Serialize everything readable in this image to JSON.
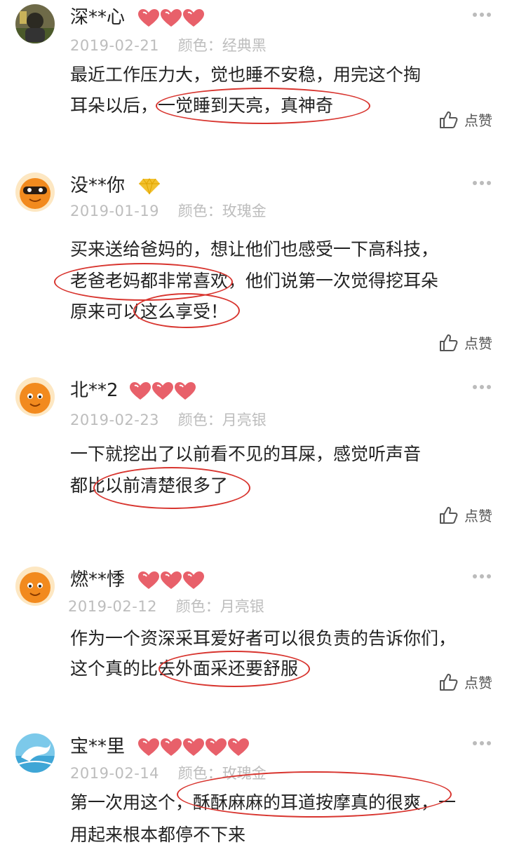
{
  "like_label": "点赞",
  "color_prefix": "颜色：",
  "reviews": [
    {
      "user": "深**心",
      "date": "2019-02-21",
      "color": "经典黑",
      "rating_type": "hearts",
      "rating": 3,
      "lines": [
        "最近工作压力大，觉也睡不安稳，用完这个掏",
        "耳朵以后，一觉睡到天亮，真神奇"
      ]
    },
    {
      "user": "没**你",
      "date": "2019-01-19",
      "color": "玫瑰金",
      "rating_type": "diamond",
      "rating": 1,
      "lines": [
        "买来送给爸妈的，想让他们也感受一下高科技，",
        "老爸老妈都非常喜欢，他们说第一次觉得挖耳朵",
        "原来可以这么享受！"
      ]
    },
    {
      "user": "北**2",
      "date": "2019-02-23",
      "color": "月亮银",
      "rating_type": "hearts",
      "rating": 3,
      "lines": [
        "一下就挖出了以前看不见的耳屎，感觉听声音",
        "都比以前清楚很多了"
      ]
    },
    {
      "user": "燃**悸",
      "date": "2019-02-12",
      "color": "月亮银",
      "rating_type": "hearts",
      "rating": 3,
      "lines": [
        "作为一个资深采耳爱好者可以很负责的告诉你们，",
        "这个真的比去外面采还要舒服"
      ]
    },
    {
      "user": "宝**里",
      "date": "2019-02-14",
      "color": "玫瑰金",
      "rating_type": "hearts",
      "rating": 5,
      "lines": [
        "第一次用这个，酥酥麻麻的耳道按摩真的很爽，一",
        "用起来根本都停不下来"
      ]
    }
  ],
  "colors": {
    "accent_circle": "#d8352f",
    "heart": "#e8606a",
    "diamond": "#f2c12e",
    "meta_text": "#bdbdbd",
    "body_text": "#222222"
  }
}
